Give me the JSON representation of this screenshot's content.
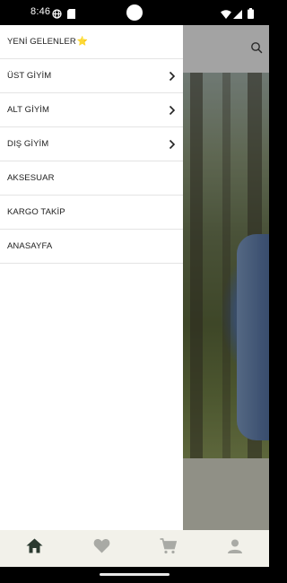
{
  "status_bar": {
    "time": "8:46",
    "icons": [
      "vpn-globe-icon",
      "sd-card-icon",
      "wifi-icon",
      "cell-signal-icon",
      "battery-icon"
    ]
  },
  "drawer": {
    "items": [
      {
        "label": "YENİ GELENLER",
        "badge": "⭐",
        "has_chevron": false
      },
      {
        "label": "ÜST GİYİM",
        "has_chevron": true
      },
      {
        "label": "ALT GİYİM",
        "has_chevron": true
      },
      {
        "label": "DIŞ GİYİM",
        "has_chevron": true
      },
      {
        "label": "AKSESUAR",
        "has_chevron": false
      },
      {
        "label": "KARGO TAKİP",
        "has_chevron": false
      },
      {
        "label": "ANASAYFA",
        "has_chevron": false
      }
    ]
  },
  "bottom_nav": {
    "items": [
      {
        "icon": "home-icon",
        "active": true
      },
      {
        "icon": "heart-icon",
        "active": false
      },
      {
        "icon": "cart-icon",
        "active": false
      },
      {
        "icon": "account-icon",
        "active": false
      }
    ],
    "active_color": "#2b3a30",
    "inactive_color": "#a9aaa5"
  },
  "colors": {
    "drawer_bg": "#ffffff",
    "divider": "#e4e4e4",
    "scrim": "rgba(0,0,0,0.33)",
    "nav_bg": "#f2f1ea"
  }
}
